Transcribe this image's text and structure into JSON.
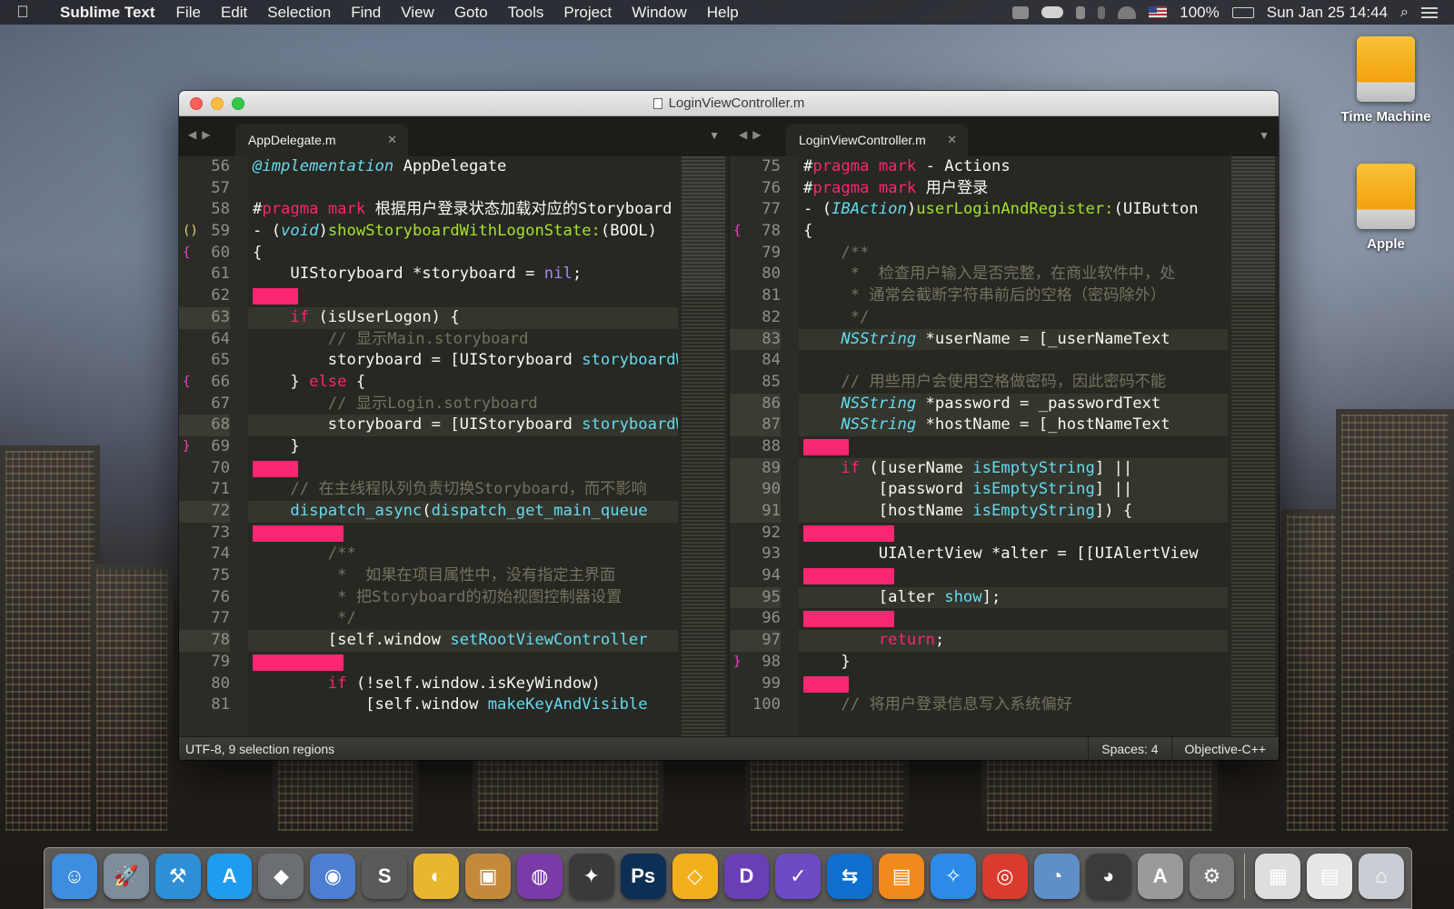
{
  "menubar": {
    "app_name": "Sublime Text",
    "items": [
      "File",
      "Edit",
      "Selection",
      "Find",
      "View",
      "Goto",
      "Tools",
      "Project",
      "Window",
      "Help"
    ],
    "battery": "100%",
    "datetime": "Sun Jan 25  14:44"
  },
  "desktop": {
    "icons": [
      {
        "label": "Time Machine",
        "icon": "drive-icon"
      },
      {
        "label": "Apple",
        "icon": "drive-icon"
      }
    ]
  },
  "window": {
    "title": "LoginViewController.m"
  },
  "left_pane": {
    "tab_label": "AppDelegate.m",
    "lines": [
      {
        "n": "56",
        "m": "",
        "sel": 0,
        "html": "<span style=\"color:#66d9ef;font-style:italic\">@implementation</span> AppDelegate"
      },
      {
        "n": "57",
        "m": "",
        "sel": 0,
        "html": ""
      },
      {
        "n": "58",
        "m": "",
        "sel": 0,
        "html": "#<span style=\"color:#f92672\">pragma</span> <span style=\"color:#f92672\">mark</span> 根据用户登录状态加载对应的Storyboard"
      },
      {
        "n": "59",
        "m": "()",
        "sel": 0,
        "html": "- (<span style=\"color:#66d9ef;font-style:italic\">void</span>)<span style=\"color:#a6e22e\">showStoryboardWithLogonState:</span>(BOOL)"
      },
      {
        "n": "60",
        "m": "{",
        "sel": 0,
        "html": "{"
      },
      {
        "n": "61",
        "m": "",
        "sel": 0,
        "html": "    UIStoryboard *storyboard = <span style=\"color:#ae81ff\">nil</span>;"
      },
      {
        "n": "62",
        "m": "",
        "sel": 50,
        "html": ""
      },
      {
        "n": "63",
        "m": "()",
        "sel": 0,
        "hl": true,
        "html": "    <span style=\"color:#f92672\">if</span> (isUserLogon) {"
      },
      {
        "n": "64",
        "m": "",
        "sel": 0,
        "html": "        <span style=\"color:#75715e\">// 显示Main.storyboard</span>"
      },
      {
        "n": "65",
        "m": "",
        "sel": 0,
        "html": "        storyboard = [UIStoryboard <span style=\"color:#66d9ef\">storyboardWithName</span>"
      },
      {
        "n": "66",
        "m": "{",
        "sel": 0,
        "html": "    } <span style=\"color:#f92672\">else</span> {"
      },
      {
        "n": "67",
        "m": "",
        "sel": 0,
        "html": "        <span style=\"color:#75715e\">// 显示Login.sotryboard</span>"
      },
      {
        "n": "68",
        "m": "",
        "sel": 0,
        "hl": true,
        "html": "        storyboard = [UIStoryboard <span style=\"color:#66d9ef\">storyboardWithName</span>"
      },
      {
        "n": "69",
        "m": "}",
        "sel": 0,
        "html": "    }"
      },
      {
        "n": "70",
        "m": "",
        "sel": 50,
        "html": ""
      },
      {
        "n": "71",
        "m": "",
        "sel": 0,
        "html": "    <span style=\"color:#75715e\">// 在主线程队列负责切换Storyboard，而不影响</span>"
      },
      {
        "n": "72",
        "m": "(",
        "sel": 0,
        "hl": true,
        "html": "    <span style=\"color:#66d9ef\">dispatch_async</span>(<span style=\"color:#66d9ef\">dispatch_get_main_queue</span>"
      },
      {
        "n": "73",
        "m": "",
        "sel": 100,
        "html": ""
      },
      {
        "n": "74",
        "m": "",
        "sel": 0,
        "html": "        <span style=\"color:#75715e\">/**</span>"
      },
      {
        "n": "75",
        "m": "",
        "sel": 0,
        "html": "<span style=\"color:#75715e\">         *  如果在项目属性中，没有指定主界面</span>"
      },
      {
        "n": "76",
        "m": "",
        "sel": 0,
        "html": "<span style=\"color:#75715e\">         * 把Storyboard的初始视图控制器设置</span>"
      },
      {
        "n": "77",
        "m": "",
        "sel": 0,
        "html": "<span style=\"color:#75715e\">         */</span>"
      },
      {
        "n": "78",
        "m": "[]",
        "sel": 0,
        "hl": true,
        "html": "        [self.window <span style=\"color:#66d9ef\">setRootViewController</span>"
      },
      {
        "n": "79",
        "m": "",
        "sel": 100,
        "html": ""
      },
      {
        "n": "80",
        "m": "",
        "sel": 0,
        "html": "        <span style=\"color:#f92672\">if</span> (!self.window.isKeyWindow)"
      },
      {
        "n": "81",
        "m": "",
        "sel": 0,
        "html": "            [self.window <span style=\"color:#66d9ef\">makeKeyAndVisible</span>"
      }
    ]
  },
  "right_pane": {
    "tab_label": "LoginViewController.m",
    "lines": [
      {
        "n": "75",
        "m": "",
        "sel": 0,
        "html": "#<span style=\"color:#f92672\">pragma</span> <span style=\"color:#f92672\">mark</span> - Actions"
      },
      {
        "n": "76",
        "m": "",
        "sel": 0,
        "html": "#<span style=\"color:#f92672\">pragma</span> <span style=\"color:#f92672\">mark</span> 用户登录"
      },
      {
        "n": "77",
        "m": "",
        "sel": 0,
        "html": "- (<span style=\"color:#66d9ef;font-style:italic\">IBAction</span>)<span style=\"color:#a6e22e\">userLoginAndRegister:</span>(UIButton"
      },
      {
        "n": "78",
        "m": "{",
        "sel": 0,
        "html": "{"
      },
      {
        "n": "79",
        "m": "",
        "sel": 0,
        "html": "    <span style=\"color:#75715e\">/**</span>"
      },
      {
        "n": "80",
        "m": "",
        "sel": 0,
        "html": "<span style=\"color:#75715e\">     *  检查用户输入是否完整，在商业软件中，处</span>"
      },
      {
        "n": "81",
        "m": "",
        "sel": 0,
        "html": "<span style=\"color:#75715e\">     * 通常会截断字符串前后的空格（密码除外）</span>"
      },
      {
        "n": "82",
        "m": "",
        "sel": 0,
        "html": "<span style=\"color:#75715e\">     */</span>"
      },
      {
        "n": "83",
        "m": "[]",
        "sel": 0,
        "hl": true,
        "html": "    <span style=\"color:#66d9ef;font-style:italic\">NSString</span> *userName = [_userNameText"
      },
      {
        "n": "84",
        "m": "",
        "sel": 0,
        "html": ""
      },
      {
        "n": "85",
        "m": "",
        "sel": 0,
        "html": "    <span style=\"color:#75715e\">// 用些用户会使用空格做密码，因此密码不能</span>"
      },
      {
        "n": "86",
        "m": "",
        "sel": 0,
        "hl": true,
        "html": "    <span style=\"color:#66d9ef;font-style:italic\">NSString</span> *password = _passwordText"
      },
      {
        "n": "87",
        "m": "",
        "sel": 0,
        "hl": true,
        "html": "    <span style=\"color:#66d9ef;font-style:italic\">NSString</span> *hostName = [_hostNameText"
      },
      {
        "n": "88",
        "m": "",
        "sel": 50,
        "html": ""
      },
      {
        "n": "89",
        "m": "[]",
        "sel": 0,
        "hl": true,
        "html": "    <span style=\"color:#f92672\">if</span> ([userName <span style=\"color:#66d9ef\">isEmptyString</span>] ||"
      },
      {
        "n": "90",
        "m": "[]",
        "sel": 0,
        "hl": true,
        "html": "        [password <span style=\"color:#66d9ef\">isEmptyString</span>] ||"
      },
      {
        "n": "91",
        "m": "{",
        "sel": 0,
        "hl": true,
        "html": "        [hostName <span style=\"color:#66d9ef\">isEmptyString</span>]) {"
      },
      {
        "n": "92",
        "m": "",
        "sel": 100,
        "html": ""
      },
      {
        "n": "93",
        "m": "",
        "sel": 0,
        "html": "        UIAlertView *alter = [[UIAlertView"
      },
      {
        "n": "94",
        "m": "",
        "sel": 100,
        "html": ""
      },
      {
        "n": "95",
        "m": "[]",
        "sel": 0,
        "hl": true,
        "html": "        [alter <span style=\"color:#66d9ef\">show</span>];"
      },
      {
        "n": "96",
        "m": "",
        "sel": 100,
        "html": ""
      },
      {
        "n": "97",
        "m": "",
        "sel": 0,
        "hl": true,
        "html": "        <span style=\"color:#f92672\">return</span>;"
      },
      {
        "n": "98",
        "m": "}",
        "sel": 0,
        "html": "    }"
      },
      {
        "n": "99",
        "m": "",
        "sel": 50,
        "html": ""
      },
      {
        "n": "100",
        "m": "",
        "sel": 0,
        "html": "    <span style=\"color:#75715e\">// 将用户登录信息写入系统偏好</span>"
      }
    ]
  },
  "statusbar": {
    "encoding": "UTF-8, 9 selection regions",
    "indentation": "Spaces: 4",
    "syntax": "Objective-C++"
  },
  "dock": {
    "items": [
      {
        "name": "finder-icon",
        "color": "#3d8de0",
        "glyph": "☺"
      },
      {
        "name": "launchpad-icon",
        "color": "#7e8c9b",
        "glyph": "🚀"
      },
      {
        "name": "xcode-icon",
        "color": "#2d8fd5",
        "glyph": "⚒"
      },
      {
        "name": "app-store-icon",
        "color": "#1f9bf0",
        "glyph": "A"
      },
      {
        "name": "alfred-icon",
        "color": "#6b6e73",
        "glyph": "◆"
      },
      {
        "name": "safari-like-icon",
        "color": "#4c7fd1",
        "glyph": "◉"
      },
      {
        "name": "sublime-text-icon",
        "color": "#5a5a5a",
        "glyph": "S"
      },
      {
        "name": "lemon-icon",
        "color": "#e9b72e",
        "glyph": "◐"
      },
      {
        "name": "box-icon",
        "color": "#c48a3a",
        "glyph": "▣"
      },
      {
        "name": "github-icon",
        "color": "#7a3aa8",
        "glyph": "◍"
      },
      {
        "name": "compass-icon",
        "color": "#3a3a3a",
        "glyph": "✦"
      },
      {
        "name": "photoshop-icon",
        "color": "#0c2f55",
        "glyph": "Ps"
      },
      {
        "name": "sketch-icon",
        "color": "#f3b01c",
        "glyph": "◇"
      },
      {
        "name": "dash-icon",
        "color": "#6a3fb5",
        "glyph": "D"
      },
      {
        "name": "omnifocus-icon",
        "color": "#6c4bc4",
        "glyph": "✓"
      },
      {
        "name": "teamviewer-icon",
        "color": "#0e6fcf",
        "glyph": "⇆"
      },
      {
        "name": "ibooks-icon",
        "color": "#f08a1c",
        "glyph": "▤"
      },
      {
        "name": "safari-icon",
        "color": "#2c8be6",
        "glyph": "✧"
      },
      {
        "name": "chrome-icon",
        "color": "#d93b2e",
        "glyph": "◎"
      },
      {
        "name": "weibo-icon",
        "color": "#5f8fc9",
        "glyph": "◔"
      },
      {
        "name": "qq-icon",
        "color": "#3b3b3b",
        "glyph": "◕"
      },
      {
        "name": "font-book-icon",
        "color": "#9a9a9a",
        "glyph": "A"
      },
      {
        "name": "system-preferences-icon",
        "color": "#7d7d80",
        "glyph": "⚙"
      }
    ],
    "right_items": [
      {
        "name": "downloads-stack-icon",
        "color": "#dedede",
        "glyph": "▦"
      },
      {
        "name": "documents-stack-icon",
        "color": "#e6e6e6",
        "glyph": "▤"
      },
      {
        "name": "trash-icon",
        "color": "#c9ced4",
        "glyph": "⌂"
      }
    ]
  }
}
